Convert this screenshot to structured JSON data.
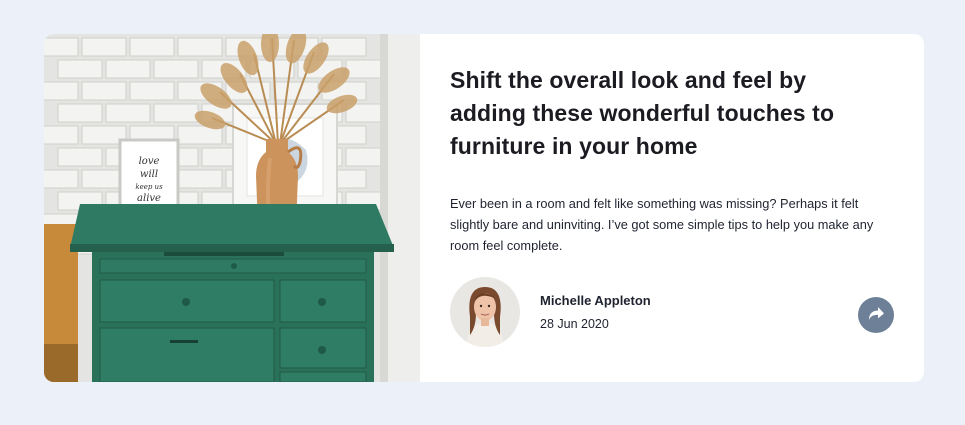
{
  "article": {
    "title": "Shift the overall look and feel by adding these wonderful touches to furniture in your home",
    "description": "Ever been in a room and felt like something was missing? Perhaps it felt slightly bare and uninviting. I’ve got some simple tips to help you make any room feel complete."
  },
  "author": {
    "name": "Michelle Appleton",
    "date": "28 Jun 2020"
  },
  "image": {
    "frame_text": [
      "love",
      "will",
      "keep us",
      "alive"
    ]
  },
  "icons": {
    "share": "share-arrow-icon"
  },
  "colors": {
    "page_background": "#ecf0f8",
    "card_background": "#ffffff",
    "heading": "#1b1b22",
    "body_text": "#1f2330",
    "share_button": "#6e8098",
    "drawer_green": "#2e7a62"
  }
}
